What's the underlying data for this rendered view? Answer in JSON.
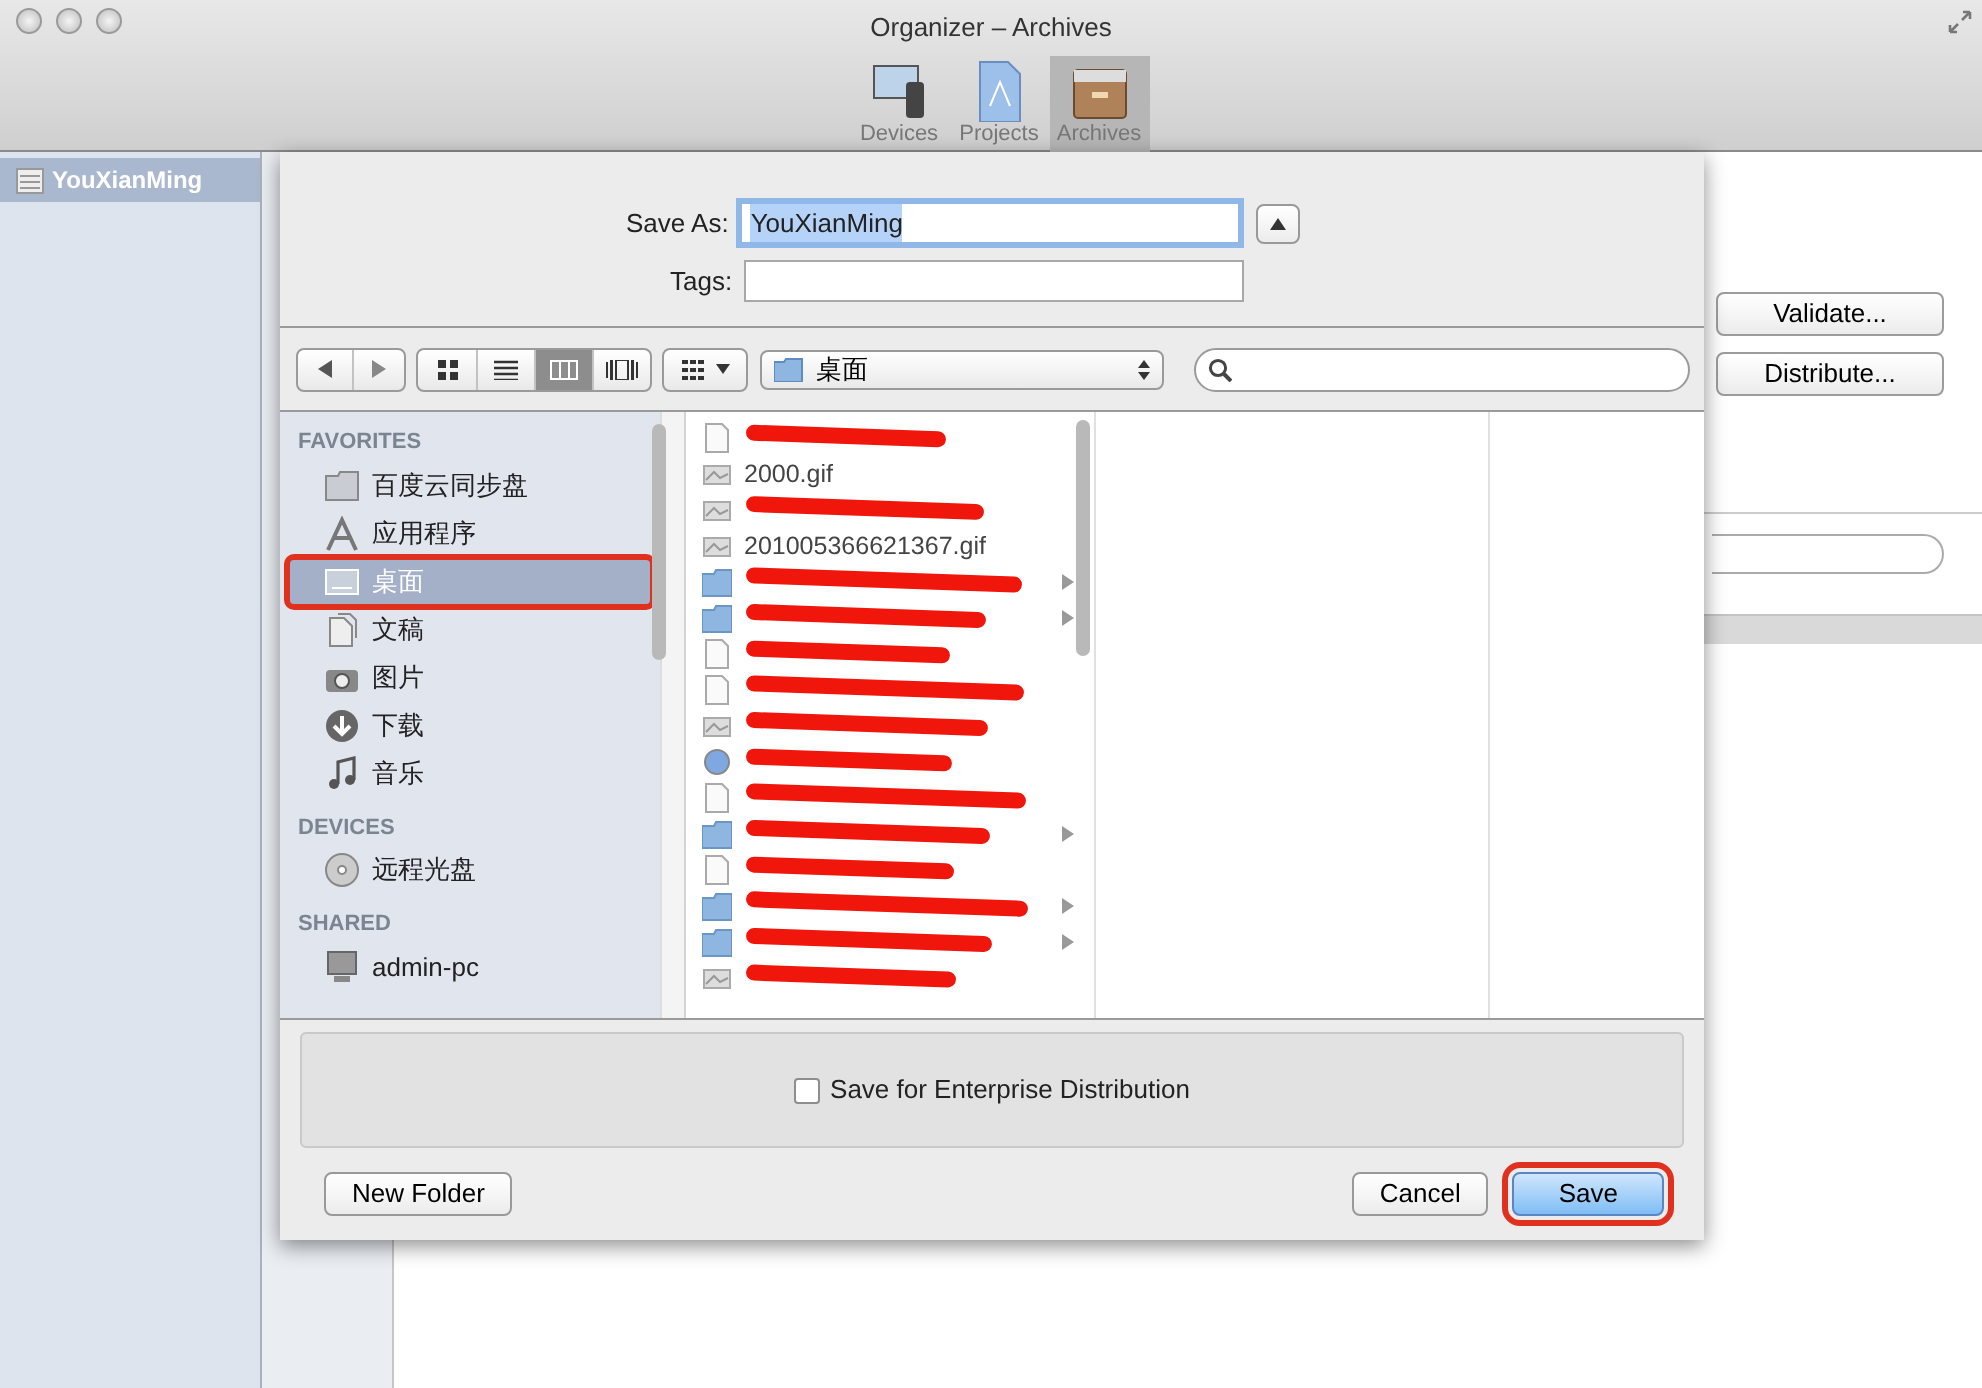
{
  "window": {
    "title": "Organizer – Archives"
  },
  "toolbar": [
    {
      "kind": "devices",
      "label": "Devices",
      "selected": false
    },
    {
      "kind": "projects",
      "label": "Projects",
      "selected": false
    },
    {
      "kind": "archives",
      "label": "Archives",
      "selected": true
    }
  ],
  "organizer_sidebar": [
    {
      "label": "YouXianMing",
      "selected": true
    }
  ],
  "organizer_buttons": [
    "Validate...",
    "Distribute..."
  ],
  "save_sheet": {
    "save_as_label": "Save As:",
    "save_as_value": "YouXianMing",
    "tags_label": "Tags:",
    "view_modes": [
      {
        "kind": "icons",
        "selected": false
      },
      {
        "kind": "list",
        "selected": false
      },
      {
        "kind": "columns",
        "selected": true
      },
      {
        "kind": "coverflow",
        "selected": false
      }
    ],
    "location": "桌面",
    "sidebar": [
      {
        "heading": "FAVORITES",
        "items": [
          {
            "kind": "folder",
            "label": "百度云同步盘",
            "selected": false,
            "highlighted": false
          },
          {
            "kind": "apps",
            "label": "应用程序",
            "selected": false,
            "highlighted": false
          },
          {
            "kind": "desktop",
            "label": "桌面",
            "selected": true,
            "highlighted": true
          },
          {
            "kind": "documents",
            "label": "文稿",
            "selected": false,
            "highlighted": false
          },
          {
            "kind": "camera",
            "label": "图片",
            "selected": false,
            "highlighted": false
          },
          {
            "kind": "download",
            "label": "下载",
            "selected": false,
            "highlighted": false
          },
          {
            "kind": "music",
            "label": "音乐",
            "selected": false,
            "highlighted": false
          }
        ]
      },
      {
        "heading": "DEVICES",
        "items": [
          {
            "kind": "disc",
            "label": "远程光盘",
            "selected": false,
            "highlighted": false
          }
        ]
      },
      {
        "heading": "SHARED",
        "items": [
          {
            "kind": "computer",
            "label": "admin-pc",
            "selected": false,
            "highlighted": false
          }
        ]
      }
    ],
    "files": [
      {
        "kind": "file",
        "redacted": true,
        "folder": false
      },
      {
        "kind": "image",
        "name": "2000.gif",
        "redacted": false,
        "folder": false
      },
      {
        "kind": "image",
        "redacted": true,
        "folder": false
      },
      {
        "kind": "image",
        "name": "201005366621367.gif",
        "redacted": false,
        "folder": false
      },
      {
        "kind": "folder",
        "redacted": true,
        "folder": true
      },
      {
        "kind": "folder",
        "redacted": true,
        "folder": true
      },
      {
        "kind": "file",
        "redacted": true,
        "folder": false
      },
      {
        "kind": "file",
        "redacted": true,
        "folder": false
      },
      {
        "kind": "image",
        "redacted": true,
        "folder": false
      },
      {
        "kind": "app",
        "redacted": true,
        "folder": false
      },
      {
        "kind": "file",
        "redacted": true,
        "folder": false
      },
      {
        "kind": "folder",
        "redacted": true,
        "folder": true
      },
      {
        "kind": "file",
        "redacted": true,
        "folder": false
      },
      {
        "kind": "folder",
        "redacted": true,
        "folder": true
      },
      {
        "kind": "folder",
        "redacted": true,
        "folder": true
      },
      {
        "kind": "image",
        "redacted": true,
        "folder": false
      }
    ],
    "enterprise_checkbox": {
      "label": "Save for Enterprise Distribution",
      "checked": false
    },
    "buttons": [
      {
        "kind": "new_folder",
        "label": "New Folder",
        "default": false,
        "highlighted": false
      },
      {
        "kind": "cancel",
        "label": "Cancel",
        "default": false,
        "highlighted": false
      },
      {
        "kind": "save",
        "label": "Save",
        "default": true,
        "highlighted": true
      }
    ]
  }
}
